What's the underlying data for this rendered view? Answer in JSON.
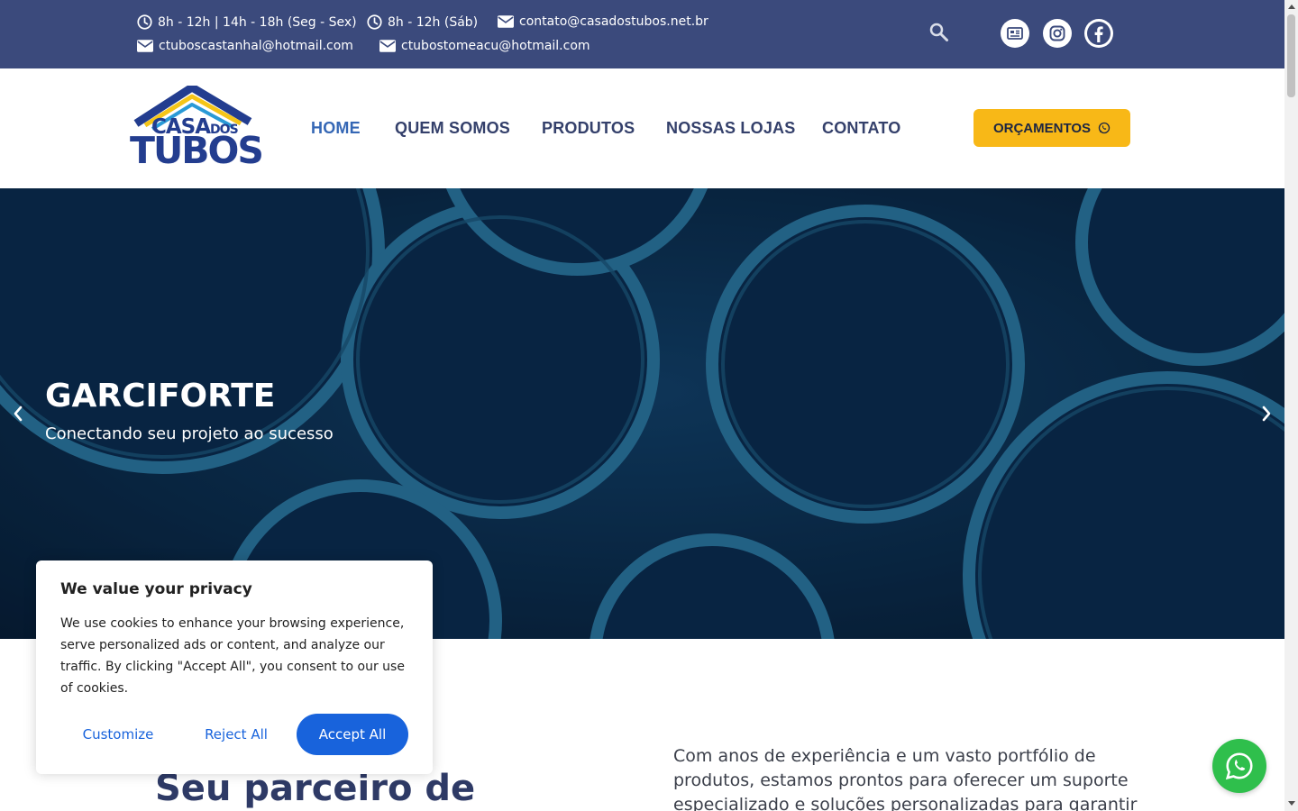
{
  "topbar": {
    "hours_week": "8h - 12h | 14h - 18h (Seg - Sex)",
    "hours_sat": "8h - 12h (Sáb)",
    "email_main": "contato@casadostubos.net.br",
    "email_castanhal": "ctuboscastanhal@hotmail.com",
    "email_tomeacu": "ctubostomeacu@hotmail.com",
    "social_icons": [
      "news-icon",
      "instagram-icon",
      "facebook-icon"
    ]
  },
  "logo": {
    "line1": "CASA",
    "line1_small": "DOS",
    "line2": "TUBOS"
  },
  "nav": {
    "items": [
      {
        "label": "HOME",
        "active": true
      },
      {
        "label": "QUEM SOMOS",
        "active": false
      },
      {
        "label": "PRODUTOS",
        "active": false
      },
      {
        "label": "NOSSAS LOJAS",
        "active": false
      },
      {
        "label": "CONTATO",
        "active": false
      }
    ],
    "cta_label": "ORÇAMENTOS"
  },
  "hero": {
    "title": "GARCIFORTE",
    "subtitle": "Conectando seu projeto ao sucesso"
  },
  "section": {
    "title": "Seu parceiro de",
    "text": "Com anos de experiência e um vasto portfólio de produtos, estamos prontos para oferecer um suporte especializado e soluções personalizadas para garantir"
  },
  "cookie": {
    "title": "We value your privacy",
    "text": "We use cookies to enhance your browsing experience, serve personalized ads or content, and analyze our traffic. By clicking \"Accept All\", you consent to our use of cookies.",
    "customize": "Customize",
    "reject": "Reject All",
    "accept": "Accept All"
  },
  "colors": {
    "topbar": "#3b4a7c",
    "cta": "#f8b817",
    "nav_active": "#3567b5",
    "cookie_accent": "#1863dc",
    "whatsapp": "#2fbf4c"
  }
}
